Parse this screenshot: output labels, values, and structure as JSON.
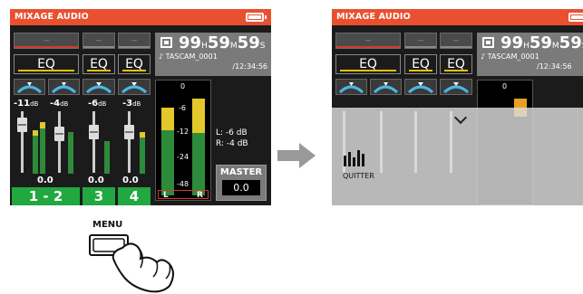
{
  "screen1": {
    "title": "MIXAGE AUDIO",
    "channels_top": [
      "--",
      "--",
      "--"
    ],
    "eq_labels": [
      "EQ",
      "EQ",
      "EQ"
    ],
    "db_values": [
      "-11",
      "-4",
      "-6",
      "-3"
    ],
    "db_unit": "dB",
    "fader_values": [
      "0.0",
      "0.0",
      "0.0"
    ],
    "channel_buttons": [
      "1 - 2",
      "3",
      "4"
    ],
    "time": {
      "h": "99",
      "h_unit": "H",
      "m": "59",
      "m_unit": "M",
      "s": "59",
      "s_unit": "S"
    },
    "filename": "♪ TASCAM_0001",
    "duration": "/12:34:56",
    "meter_ticks": [
      "0",
      "-6",
      "-12",
      "-24",
      "-48"
    ],
    "meter_left": "L",
    "meter_right": "R",
    "vol_left": "L: -6 dB",
    "vol_right": "R: -4 dB",
    "master_label": "MASTER",
    "master_value": "0.0"
  },
  "screen2": {
    "title": "MIXAGE AUDIO",
    "channels_top": [
      "--",
      "--",
      "--"
    ],
    "eq_labels": [
      "EQ",
      "EQ",
      "EQ"
    ],
    "time": {
      "h": "99",
      "h_unit": "H",
      "m": "59",
      "m_unit": "M",
      "s": "59",
      "s_unit": "S"
    },
    "filename": "♪ TASCAM_0001",
    "duration": "/12:34:56",
    "meter_tick": "0",
    "menu_item": "QUITTER"
  },
  "menu_button_label": "MENU",
  "colors": {
    "titlebar": "#e8502f",
    "channel_button": "#21a840",
    "arrow": "#999999"
  }
}
